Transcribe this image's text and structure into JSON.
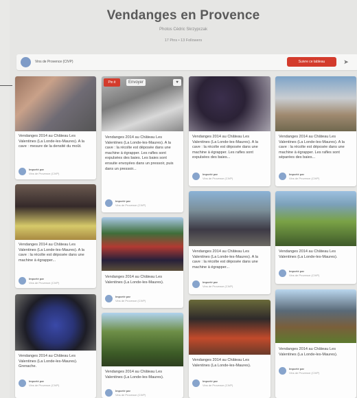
{
  "board": {
    "title": "Vendanges en Provence",
    "subtitle": "Photos Cédric Skrzypczak",
    "stats": "17 Pins  •  13 Followers",
    "owner_name": "Vins de Provence (CIVP)",
    "follow_label": "Suivre ce tableau",
    "send_icon": "send-icon"
  },
  "pin_common": {
    "pinned_by": "Importé par",
    "source": "Vins de Provence (CIVP)",
    "pin_label": "Pin it",
    "send_label": "Envoyer"
  },
  "pins": [
    {
      "desc": "Vendanges 2014 au Château Les Valentines (La Londe-les-Maures). A la cave : mesure de la densité du moût."
    },
    {
      "desc": "Vendanges 2014 au Château Les Valentines (La Londe-les-Maures). A la cave : la récolte est déposée dans une machine à égrapper. Les rafles sont expulsées des baies. Les baies sont ensuite envoyées dans un pressoir, puis dans un pressoir..."
    },
    {
      "desc": "Vendanges 2014 au Château Les Valentines (La Londe-les-Maures). A la cave : la récolte est déposée dans une machine à égrapper. Les rafles sont expulsées des baies..."
    },
    {
      "desc": "Vendanges 2014 au Château Les Valentines (La Londe-les-Maures). A la cave : la récolte est déposée dans une machine à égrapper. Les rafles sont séparées des baies..."
    },
    {
      "desc": "Vendanges 2014 au Château Les Valentines (La Londe-les-Maures). A la cave : la récolte est déposée dans une machine à égrapper..."
    },
    {
      "desc": "Vendanges 2014 au Château Les Valentines (La Londe-les-Maures)."
    },
    {
      "desc": "Vendanges 2014 au Château Les Valentines (La Londe-les-Maures). A la cave : la récolte est déposée dans une machine à égrapper..."
    },
    {
      "desc": "Vendanges 2014 au Château Les Valentines (La Londe-les-Maures)."
    },
    {
      "desc": "Vendanges 2014 au Château Les Valentines (La Londe-les-Maures). Grenache."
    },
    {
      "desc": "Vendanges 2014 au Château Les Valentines (La Londe-les-Maures)."
    },
    {
      "desc": "Vendanges 2014 au Château Les Valentines (La Londe-les-Maures)."
    },
    {
      "desc": "Vendanges 2014 au Château Les Valentines (La Londe-les-Maures)."
    }
  ]
}
